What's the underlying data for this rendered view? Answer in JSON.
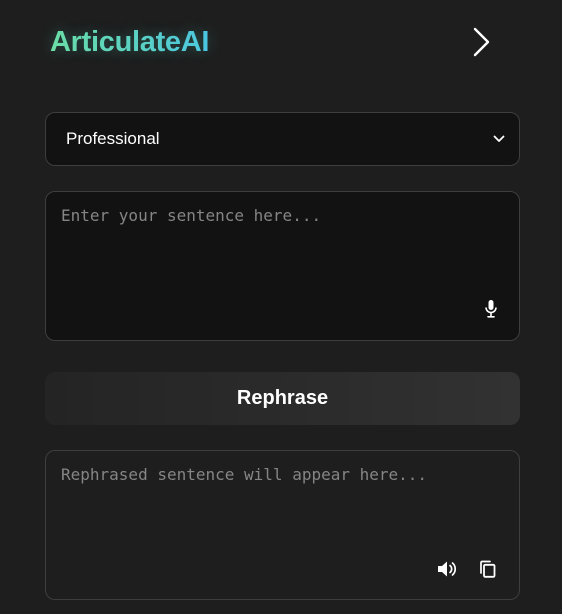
{
  "app": {
    "title": "ArticulateAI",
    "accent_gradient": [
      "#6fe0a4",
      "#4cc6e6"
    ]
  },
  "header": {
    "collapse_icon": "chevron-right-icon"
  },
  "tone_select": {
    "selected": "Professional",
    "icon": "chevron-down-icon"
  },
  "input": {
    "placeholder": "Enter your sentence here...",
    "value": "",
    "mic_icon": "microphone-icon"
  },
  "actions": {
    "rephrase_label": "Rephrase"
  },
  "output": {
    "placeholder": "Rephrased sentence will appear here...",
    "speaker_icon": "speaker-icon",
    "copy_icon": "copy-icon"
  }
}
